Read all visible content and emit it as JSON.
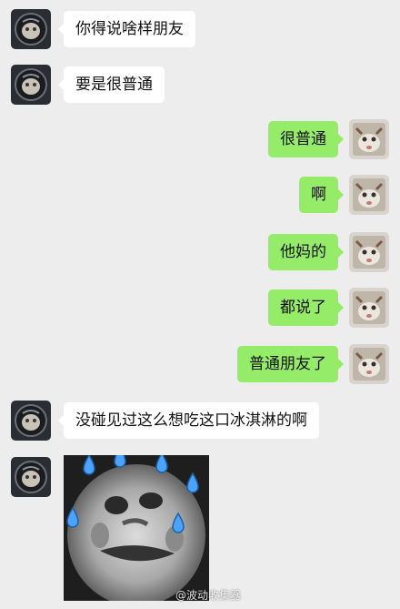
{
  "messages": [
    {
      "side": "in",
      "text": "你得说啥样朋友"
    },
    {
      "side": "in",
      "text": "要是很普通"
    },
    {
      "side": "out",
      "text": "很普通"
    },
    {
      "side": "out",
      "text": "啊"
    },
    {
      "side": "out",
      "text": "他妈的"
    },
    {
      "side": "out",
      "text": "都说了"
    },
    {
      "side": "out",
      "text": "普通朋友了"
    },
    {
      "side": "in",
      "text": "没碰见过这么想吃这口冰淇淋的啊"
    }
  ],
  "sticker": {
    "type": "sweating-face-meme",
    "icon": "sweat-drops-icon"
  },
  "watermark": "@波动收集器",
  "colors": {
    "background": "#ededed",
    "incoming_bubble": "#ffffff",
    "outgoing_bubble": "#95ec69",
    "text": "#111111"
  }
}
